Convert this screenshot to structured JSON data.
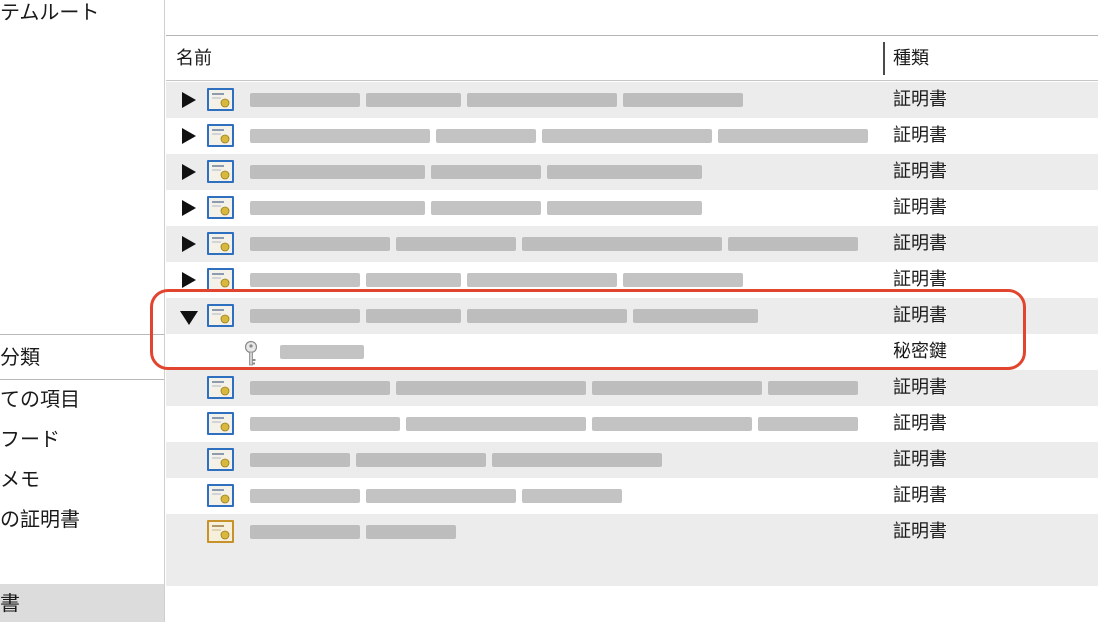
{
  "sidebar": {
    "keychains_partial": "テムルート",
    "category_header": "分類",
    "categories": [
      {
        "label": "ての項目"
      },
      {
        "label": "フード"
      },
      {
        "label": "メモ"
      },
      {
        "label": "の証明書"
      },
      {
        "label": ""
      },
      {
        "label": "書"
      }
    ]
  },
  "columns": {
    "name": "名前",
    "kind": "種類"
  },
  "rows": [
    {
      "kind": "証明書",
      "icon": "certificate-icon"
    },
    {
      "kind": "証明書",
      "icon": "certificate-icon"
    },
    {
      "kind": "証明書",
      "icon": "certificate-icon"
    },
    {
      "kind": "証明書",
      "icon": "certificate-icon"
    },
    {
      "kind": "証明書",
      "icon": "certificate-icon"
    },
    {
      "kind": "証明書",
      "icon": "certificate-icon"
    },
    {
      "kind": "証明書",
      "icon": "certificate-icon"
    },
    {
      "kind": "秘密鍵",
      "icon": "key-icon"
    },
    {
      "kind": "証明書",
      "icon": "certificate-icon"
    },
    {
      "kind": "証明書",
      "icon": "certificate-icon"
    },
    {
      "kind": "証明書",
      "icon": "certificate-icon"
    },
    {
      "kind": "証明書",
      "icon": "certificate-icon"
    },
    {
      "kind": "証明書",
      "icon": "certificate-icon"
    }
  ],
  "colors": {
    "highlight": "#e2452f",
    "zebra": "#ececec",
    "selection": "#dcdcdc"
  }
}
